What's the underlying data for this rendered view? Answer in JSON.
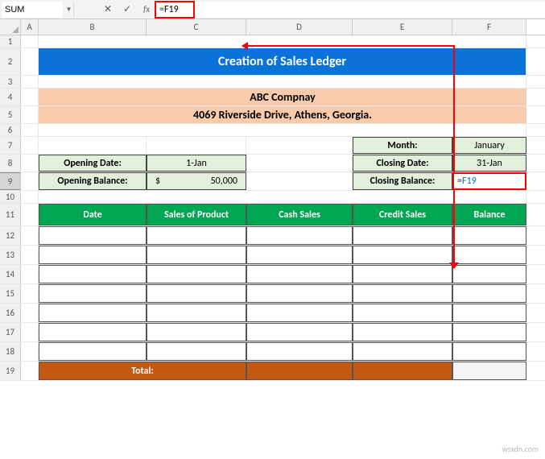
{
  "nameBox": "SUM",
  "formula": "=F19",
  "columns": [
    "A",
    "B",
    "C",
    "D",
    "E",
    "F"
  ],
  "rows": [
    "1",
    "2",
    "3",
    "4",
    "5",
    "6",
    "7",
    "8",
    "9",
    "10",
    "11",
    "12",
    "13",
    "14",
    "15",
    "16",
    "17",
    "18",
    "19"
  ],
  "title": "Creation of Sales Ledger",
  "company": {
    "name": "ABC Compnay",
    "address": "4069 Riverside Drive, Athens, Georgia."
  },
  "labels": {
    "openingDate": "Opening Date:",
    "openingBalance": "Opening Balance:",
    "month": "Month:",
    "closingDate": "Closing Date:",
    "closingBalance": "Closing Balance:",
    "total": "Total:"
  },
  "values": {
    "openingDate": "1-Jan",
    "openingBalanceCurrency": "$",
    "openingBalance": "50,000",
    "month": "January",
    "closingDate": "31-Jan",
    "closingBalanceDisplay": "F19",
    "closingBalanceEq": "="
  },
  "tableHeaders": [
    "Date",
    "Sales of Product",
    "Cash Sales",
    "Credit Sales",
    "Balance"
  ],
  "watermark": "wsxdn.com"
}
